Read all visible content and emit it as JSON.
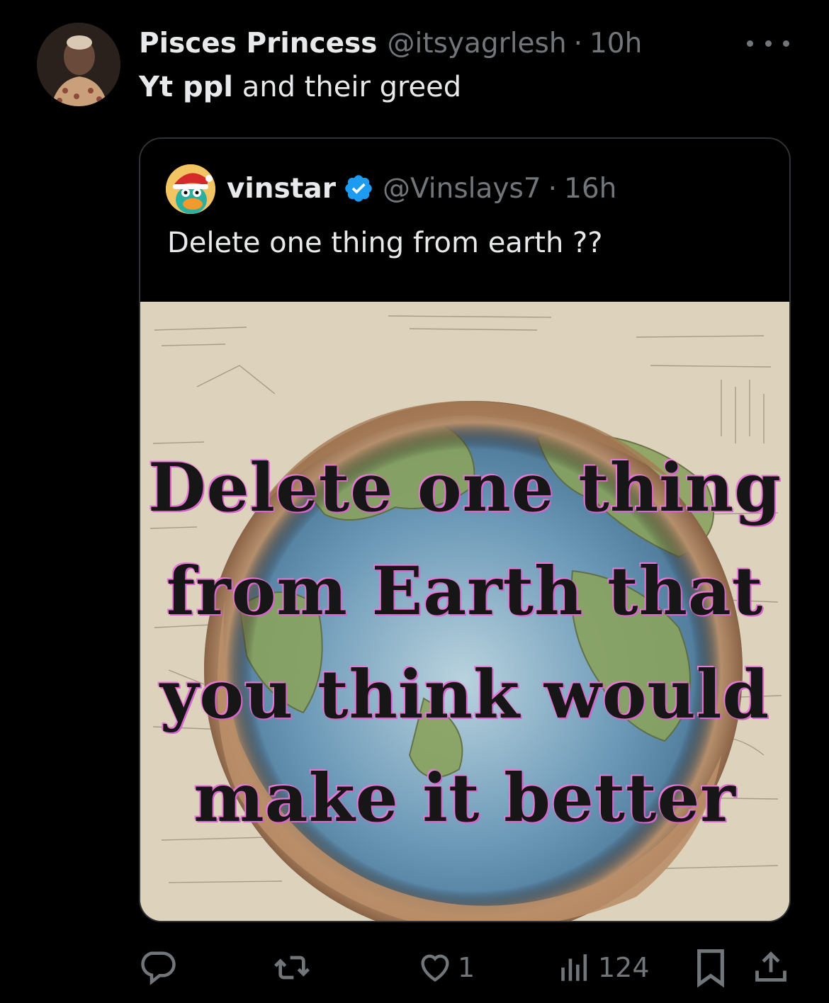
{
  "tweet": {
    "author_name": "Pisces Princess",
    "author_handle": "@itsyagrlesh",
    "separator": "·",
    "time": "10h",
    "text_bold": "Yt ppl",
    "text_rest": " and their greed"
  },
  "quote": {
    "author_name": "vinstar",
    "author_handle": "@Vinslays7",
    "separator": "·",
    "time": "16h",
    "text": "Delete one thing from earth ??",
    "image_text": [
      "Delete one thing",
      "from Earth that",
      "you think would",
      "make it better"
    ]
  },
  "actions": {
    "replies": "",
    "retweets": "",
    "likes": "1",
    "views": "124"
  },
  "icons": {
    "more": "more-icon",
    "verified": "verified-badge-icon",
    "reply": "reply-icon",
    "retweet": "retweet-icon",
    "like": "like-icon",
    "views": "views-icon",
    "bookmark": "bookmark-icon",
    "share": "share-icon"
  },
  "colors": {
    "background": "#000000",
    "text": "#e7e9ea",
    "muted": "#71767b",
    "verified": "#1d9bf0",
    "border": "#2f3336"
  }
}
